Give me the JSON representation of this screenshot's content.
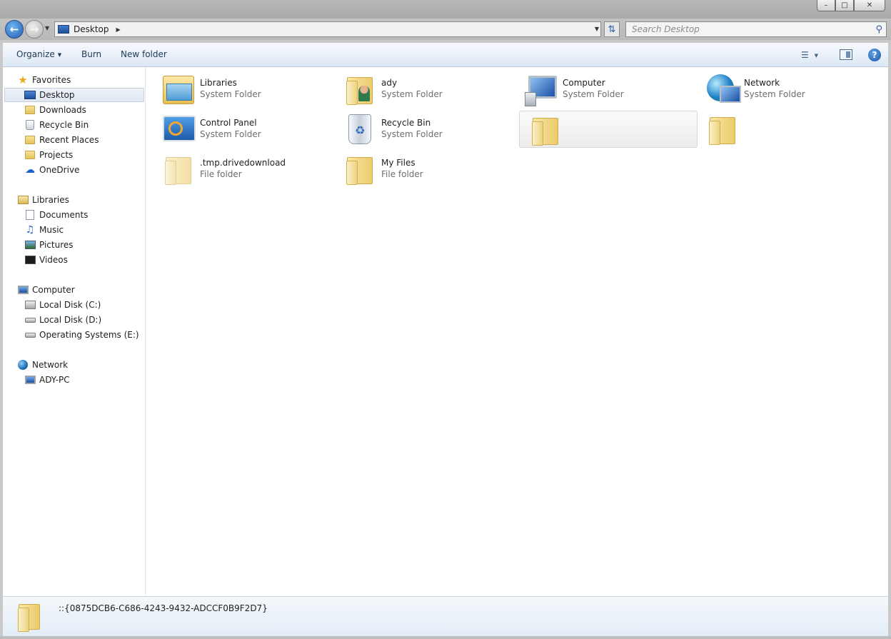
{
  "window": {
    "minimize_glyph": "–",
    "maximize_glyph": "□",
    "close_glyph": "✕"
  },
  "address_bar": {
    "icon": "desktop-icon",
    "location": "Desktop",
    "search_placeholder": "Search Desktop"
  },
  "toolbar": {
    "organize": "Organize",
    "burn": "Burn",
    "new_folder": "New folder"
  },
  "sidebar": {
    "favorites": {
      "label": "Favorites",
      "items": [
        {
          "label": "Desktop",
          "icon": "desktop-icon",
          "selected": true
        },
        {
          "label": "Downloads",
          "icon": "downloads-folder-icon"
        },
        {
          "label": "Recycle Bin",
          "icon": "recycle-bin-icon"
        },
        {
          "label": "Recent Places",
          "icon": "recent-places-icon"
        },
        {
          "label": "Projects",
          "icon": "folder-icon"
        },
        {
          "label": "OneDrive",
          "icon": "onedrive-icon"
        }
      ]
    },
    "libraries": {
      "label": "Libraries",
      "items": [
        {
          "label": "Documents",
          "icon": "documents-icon"
        },
        {
          "label": "Music",
          "icon": "music-icon"
        },
        {
          "label": "Pictures",
          "icon": "pictures-icon"
        },
        {
          "label": "Videos",
          "icon": "videos-icon"
        }
      ]
    },
    "computer": {
      "label": "Computer",
      "items": [
        {
          "label": "Local Disk (C:)",
          "icon": "system-drive-icon"
        },
        {
          "label": "Local Disk (D:)",
          "icon": "drive-icon"
        },
        {
          "label": "Operating Systems (E:)",
          "icon": "drive-icon"
        }
      ]
    },
    "network": {
      "label": "Network",
      "items": [
        {
          "label": "ADY-PC",
          "icon": "pc-icon"
        }
      ]
    }
  },
  "files": [
    {
      "name": "Libraries",
      "type": "System Folder",
      "icon": "libraries-icon"
    },
    {
      "name": "ady",
      "type": "System Folder",
      "icon": "user-folder-icon"
    },
    {
      "name": "Computer",
      "type": "System Folder",
      "icon": "computer-icon"
    },
    {
      "name": "Network",
      "type": "System Folder",
      "icon": "network-icon"
    },
    {
      "name": "Control Panel",
      "type": "System Folder",
      "icon": "control-panel-icon"
    },
    {
      "name": "Recycle Bin",
      "type": "System Folder",
      "icon": "recycle-bin-icon"
    },
    {
      "name": "",
      "type": "",
      "icon": "folder-icon",
      "hovered": true
    },
    {
      "name": "",
      "type": "",
      "icon": "folder-icon"
    },
    {
      "name": ".tmp.drivedownload",
      "type": "File folder",
      "icon": "folder-icon"
    },
    {
      "name": "My Files",
      "type": "File folder",
      "icon": "folder-icon"
    }
  ],
  "details_pane": {
    "name": "::{0875DCB6-C686-4243-9432-ADCCF0B9F2D7}",
    "icon": "folder-icon"
  }
}
